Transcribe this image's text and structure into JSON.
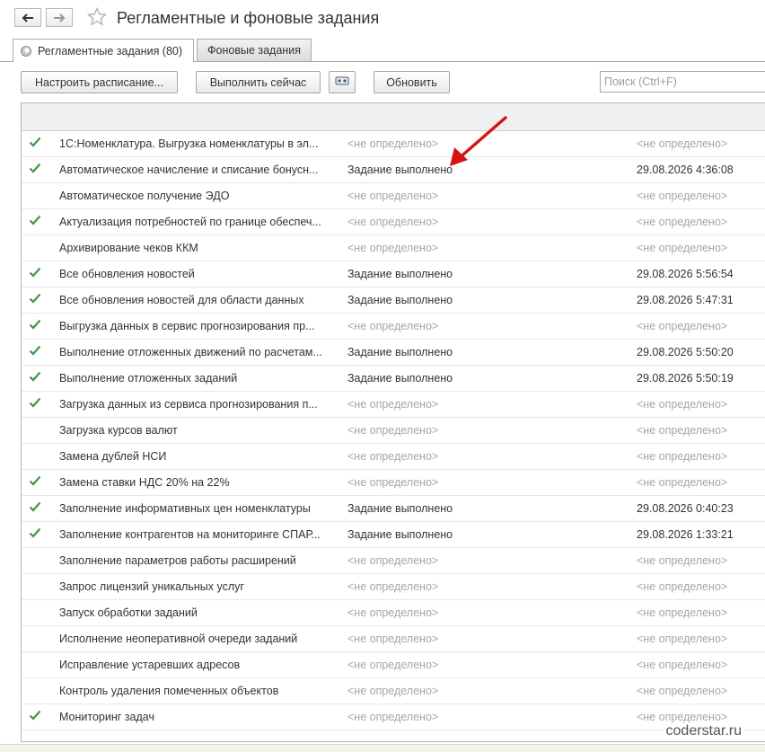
{
  "window": {
    "title": "Регламентные и фоновые задания"
  },
  "tabs": [
    {
      "label": "Регламентные задания (80)"
    },
    {
      "label": "Фоновые задания"
    }
  ],
  "toolbar": {
    "configure_label": "Настроить расписание...",
    "run_now_label": "Выполнить сейчас",
    "refresh_label": "Обновить",
    "search_placeholder": "Поиск (Ctrl+F)"
  },
  "icons": {
    "back": "arrow-left-icon",
    "forward": "arrow-right-icon",
    "favorite": "star-icon",
    "tab": "clock-icon",
    "settings": "settings-icon",
    "done": "check-icon"
  },
  "colors": {
    "check": "#3a9a4a",
    "muted": "#a6a6a6",
    "arrow": "#d21414"
  },
  "table": {
    "rows": [
      {
        "done": true,
        "name": "1С:Номенклатура. Выгрузка номенклатуры в эл...",
        "state": "<не определено>",
        "state_muted": true,
        "date": "<не определено>",
        "date_muted": true
      },
      {
        "done": true,
        "name": "Автоматическое начисление и списание бонусн...",
        "state": "Задание выполнено",
        "state_muted": false,
        "date": "29.08.2026 4:36:08",
        "date_muted": false
      },
      {
        "done": false,
        "name": "Автоматическое получение ЭДО",
        "state": "<не определено>",
        "state_muted": true,
        "date": "<не определено>",
        "date_muted": true
      },
      {
        "done": true,
        "name": "Актуализация потребностей по границе обеспеч...",
        "state": "<не определено>",
        "state_muted": true,
        "date": "<не определено>",
        "date_muted": true
      },
      {
        "done": false,
        "name": "Архивирование чеков ККМ",
        "state": "<не определено>",
        "state_muted": true,
        "date": "<не определено>",
        "date_muted": true
      },
      {
        "done": true,
        "name": "Все обновления новостей",
        "state": "Задание выполнено",
        "state_muted": false,
        "date": "29.08.2026 5:56:54",
        "date_muted": false
      },
      {
        "done": true,
        "name": "Все обновления новостей для области данных",
        "state": "Задание выполнено",
        "state_muted": false,
        "date": "29.08.2026 5:47:31",
        "date_muted": false
      },
      {
        "done": true,
        "name": "Выгрузка данных в сервис прогнозирования пр...",
        "state": "<не определено>",
        "state_muted": true,
        "date": "<не определено>",
        "date_muted": true
      },
      {
        "done": true,
        "name": "Выполнение отложенных движений по расчетам...",
        "state": "Задание выполнено",
        "state_muted": false,
        "date": "29.08.2026 5:50:20",
        "date_muted": false
      },
      {
        "done": true,
        "name": "Выполнение отложенных заданий",
        "state": "Задание выполнено",
        "state_muted": false,
        "date": "29.08.2026 5:50:19",
        "date_muted": false
      },
      {
        "done": true,
        "name": "Загрузка данных из сервиса прогнозирования п...",
        "state": "<не определено>",
        "state_muted": true,
        "date": "<не определено>",
        "date_muted": true
      },
      {
        "done": false,
        "name": "Загрузка курсов валют",
        "state": "<не определено>",
        "state_muted": true,
        "date": "<не определено>",
        "date_muted": true
      },
      {
        "done": false,
        "name": "Замена дублей НСИ",
        "state": "<не определено>",
        "state_muted": true,
        "date": "<не определено>",
        "date_muted": true
      },
      {
        "done": true,
        "name": "Замена ставки НДС 20% на 22%",
        "state": "<не определено>",
        "state_muted": true,
        "date": "<не определено>",
        "date_muted": true
      },
      {
        "done": true,
        "name": "Заполнение информативных цен номенклатуры",
        "state": "Задание выполнено",
        "state_muted": false,
        "date": "29.08.2026 0:40:23",
        "date_muted": false
      },
      {
        "done": true,
        "name": "Заполнение контрагентов на мониторинге СПАР...",
        "state": "Задание выполнено",
        "state_muted": false,
        "date": "29.08.2026 1:33:21",
        "date_muted": false
      },
      {
        "done": false,
        "name": "Заполнение параметров работы расширений",
        "state": "<не определено>",
        "state_muted": true,
        "date": "<не определено>",
        "date_muted": true
      },
      {
        "done": false,
        "name": "Запрос лицензий уникальных услуг",
        "state": "<не определено>",
        "state_muted": true,
        "date": "<не определено>",
        "date_muted": true
      },
      {
        "done": false,
        "name": "Запуск обработки заданий",
        "state": "<не определено>",
        "state_muted": true,
        "date": "<не определено>",
        "date_muted": true
      },
      {
        "done": false,
        "name": "Исполнение неоперативной очереди заданий",
        "state": "<не определено>",
        "state_muted": true,
        "date": "<не определено>",
        "date_muted": true
      },
      {
        "done": false,
        "name": "Исправление устаревших адресов",
        "state": "<не определено>",
        "state_muted": true,
        "date": "<не определено>",
        "date_muted": true
      },
      {
        "done": false,
        "name": "Контроль удаления помеченных объектов",
        "state": "<не определено>",
        "state_muted": true,
        "date": "<не определено>",
        "date_muted": true
      },
      {
        "done": true,
        "name": "Мониторинг задач",
        "state": "<не определено>",
        "state_muted": true,
        "date": "<не определено>",
        "date_muted": true
      }
    ]
  },
  "watermark": "coderstar.ru"
}
